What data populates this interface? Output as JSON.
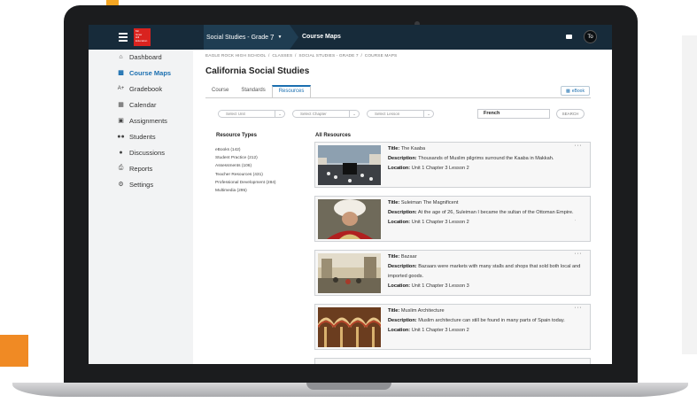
{
  "topbar": {
    "logo_lines": [
      "Mc",
      "Graw",
      "Hill",
      "Education"
    ],
    "course": "Social Studies - Grade",
    "course_grade": "7",
    "page": "Course Maps",
    "avatar": "To"
  },
  "sidebar": {
    "items": [
      {
        "label": "Dashboard",
        "icon": "home-icon"
      },
      {
        "label": "Course Maps",
        "icon": "book-icon",
        "active": true
      },
      {
        "label": "Gradebook",
        "icon": "grade-icon",
        "prefix": "A+"
      },
      {
        "label": "Calendar",
        "icon": "calendar-icon"
      },
      {
        "label": "Assignments",
        "icon": "document-icon"
      },
      {
        "label": "Students",
        "icon": "users-icon"
      },
      {
        "label": "Discussions",
        "icon": "chat-icon"
      },
      {
        "label": "Reports",
        "icon": "printer-icon"
      },
      {
        "label": "Settings",
        "icon": "gear-icon"
      }
    ]
  },
  "breadcrumb": [
    "EAGLE ROCK HIGH SCHOOL",
    "CLASSES",
    "SOCIAL STUDIES - GRADE 7",
    "COURSE MAPS"
  ],
  "page_title": "California Social Studies",
  "tabs": [
    "Course",
    "Standards",
    "Resources"
  ],
  "ebook_label": "eBook",
  "filters": {
    "unit": "Select Unit",
    "chapter": "Select Chapter",
    "lesson": "Select Lesson",
    "search_value": "French",
    "search_button": "SEARCH"
  },
  "resource_types": {
    "heading": "Resource Types",
    "items": [
      "eBooks (142)",
      "Student Practice (212)",
      "Assessments (106)",
      "Teacher Resources (431)",
      "Professional Development (284)",
      "Multimedia (295)"
    ]
  },
  "all_resources": {
    "heading": "All Resources",
    "labels": {
      "title": "Title:",
      "description": "Description:",
      "location": "Location:"
    },
    "items": [
      {
        "title": "The Kaaba",
        "description": "Thousands of Muslim pilgrims surround the Kaaba in Makkah.",
        "location": "Unit 1 Chapter 3 Lesson 2"
      },
      {
        "title": "Suleiman The Magnificent",
        "description": "At the age of 26, Suleiman I became the sultan of the Ottoman Empire.",
        "location": "Unit 1 Chapter 3 Lesson 2"
      },
      {
        "title": "Bazaar",
        "description": "Bazaars were markets with many stalls and shops that sold both local and imported goods.",
        "location": "Unit 1 Chapter 3 Lesson 3"
      },
      {
        "title": "Muslim Architecture",
        "description": "Muslim architecture can still be found in many parts of Spain today.",
        "location": "Unit 1 Chapter 3 Lesson 2"
      }
    ]
  },
  "colors": {
    "topbar": "#172b3a",
    "accent": "#1b6fb0",
    "logo": "#d9231f"
  }
}
